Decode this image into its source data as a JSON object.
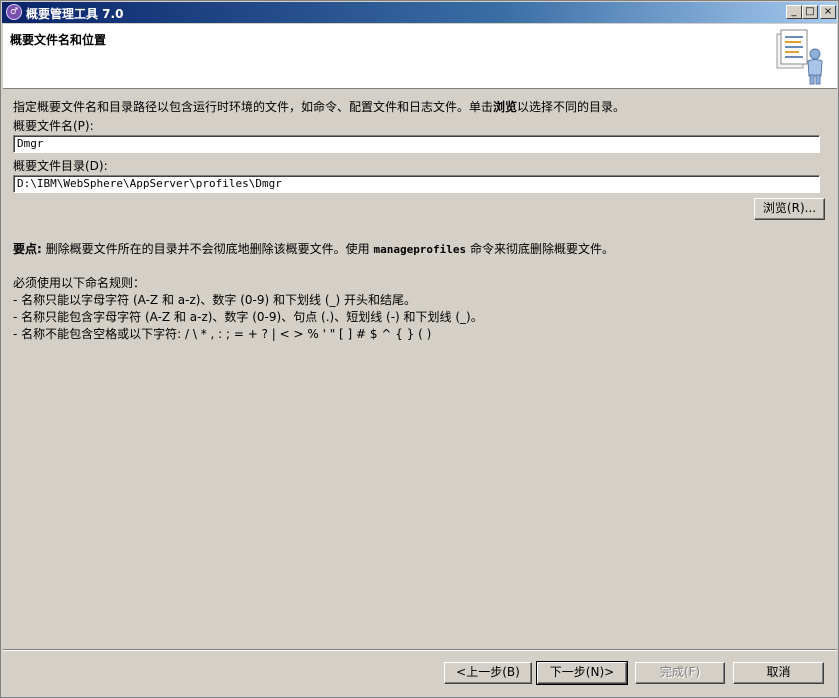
{
  "window": {
    "title": "概要管理工具 7.0",
    "minimize_label": "_",
    "maximize_label": "□",
    "close_label": "×"
  },
  "header": {
    "title": "概要文件名和位置"
  },
  "main": {
    "intro_prefix": "指定概要文件名和目录路径以包含运行时环境的文件，如命令、配置文件和日志文件。单击",
    "intro_bold": "浏览",
    "intro_suffix": "以选择不同的目录。",
    "profile_name_label": "概要文件名(P):",
    "profile_name_value": "Dmgr",
    "profile_dir_label": "概要文件目录(D):",
    "profile_dir_value": "D:\\IBM\\WebSphere\\AppServer\\profiles\\Dmgr",
    "browse_label": "浏览(R)...",
    "note_bold": "要点:",
    "note_text_1": " 删除概要文件所在的目录并不会彻底地删除该概要文件。使用 ",
    "note_command": "manageprofiles",
    "note_text_2": " 命令来彻底删除概要文件。",
    "rules_title": "必须使用以下命名规则：",
    "rules": [
      "-  名称只能以字母字符 (A-Z 和 a-z)、数字 (0-9) 和下划线 (_) 开头和结尾。",
      "-  名称只能包含字母字符 (A-Z 和 a-z)、数字 (0-9)、句点 (.)、短划线 (-) 和下划线 (_)。",
      "-  名称不能包含空格或以下字符: / \\ * , : ; = + ? | < >  % ' \" [ ] # $ ^ { } ( )"
    ]
  },
  "footer": {
    "back_label": "<上一步(B)",
    "next_label": "下一步(N)>",
    "finish_label": "完成(F)",
    "cancel_label": "取消"
  }
}
